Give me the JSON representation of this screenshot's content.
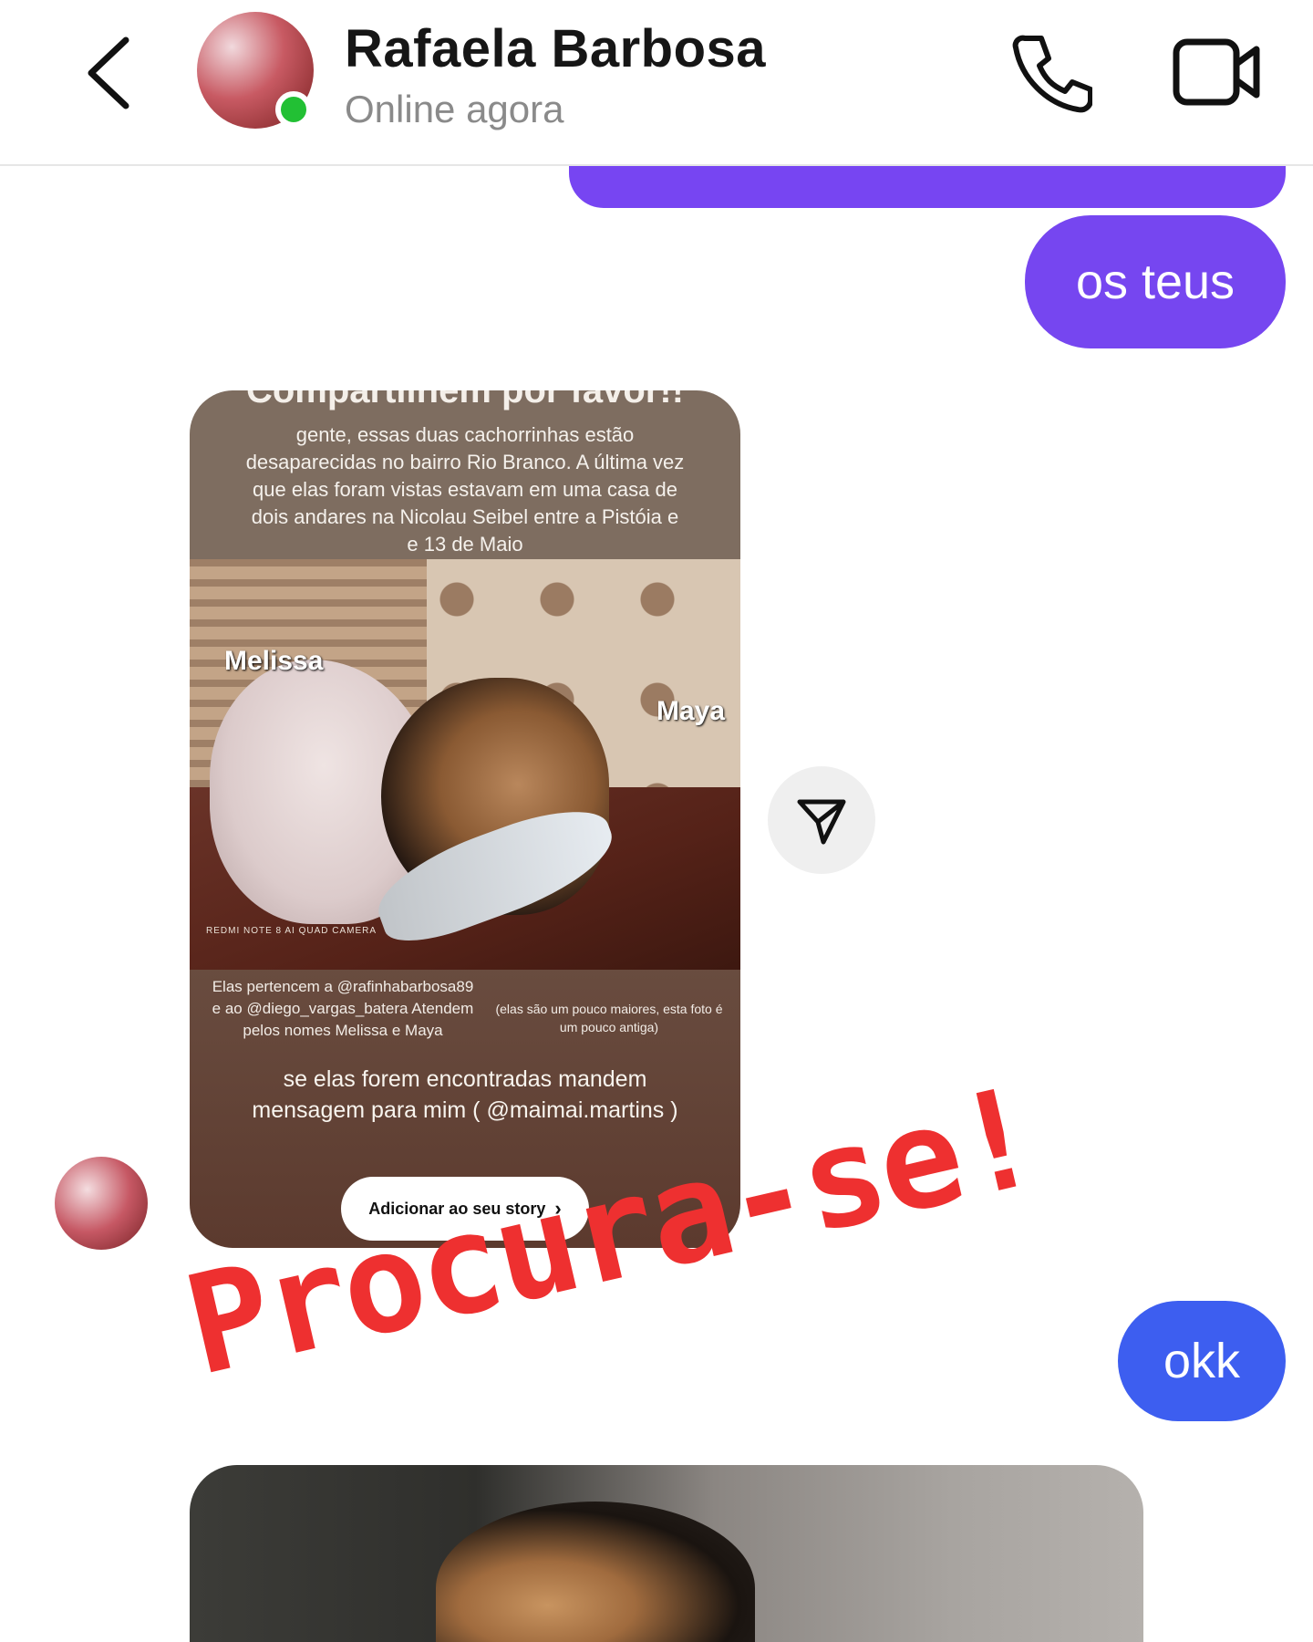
{
  "header": {
    "contact_name": "Rafaela Barbosa",
    "status": "Online agora",
    "icons": [
      "chevron-left-icon",
      "phone-icon",
      "video-camera-icon"
    ],
    "online_color": "#22c034"
  },
  "messages": {
    "sent_1": "os teus",
    "sent_2": "okk",
    "sent_bubble_color": "#7646f0",
    "sent_bubble_color_2": "#3d5ef0"
  },
  "story": {
    "heading": "Compartilhem por favor!!",
    "intro": "gente, essas duas cachorrinhas estão desaparecidas no bairro Rio Branco. A última vez que elas foram vistas estavam em uma casa de dois andares na Nicolau Seibel entre a Pistóia e e 13 de Maio",
    "dog_1": "Melissa",
    "dog_2": "Maya",
    "camera_watermark": "REDMI NOTE 8 AI QUAD CAMERA",
    "owners_note": "Elas pertencem a @rafinhabarbosa89 e ao @diego_vargas_batera Atendem pelos nomes Melissa e Maya",
    "age_note": "(elas são um pouco maiores, esta foto é um pouco antiga)",
    "contact_note": "se elas forem encontradas mandem mensagem para mim ( @maimai.martins )",
    "add_button": "Adicionar ao seu story"
  },
  "sticker": {
    "text": "Procura-se!",
    "color": "#ee3030"
  }
}
